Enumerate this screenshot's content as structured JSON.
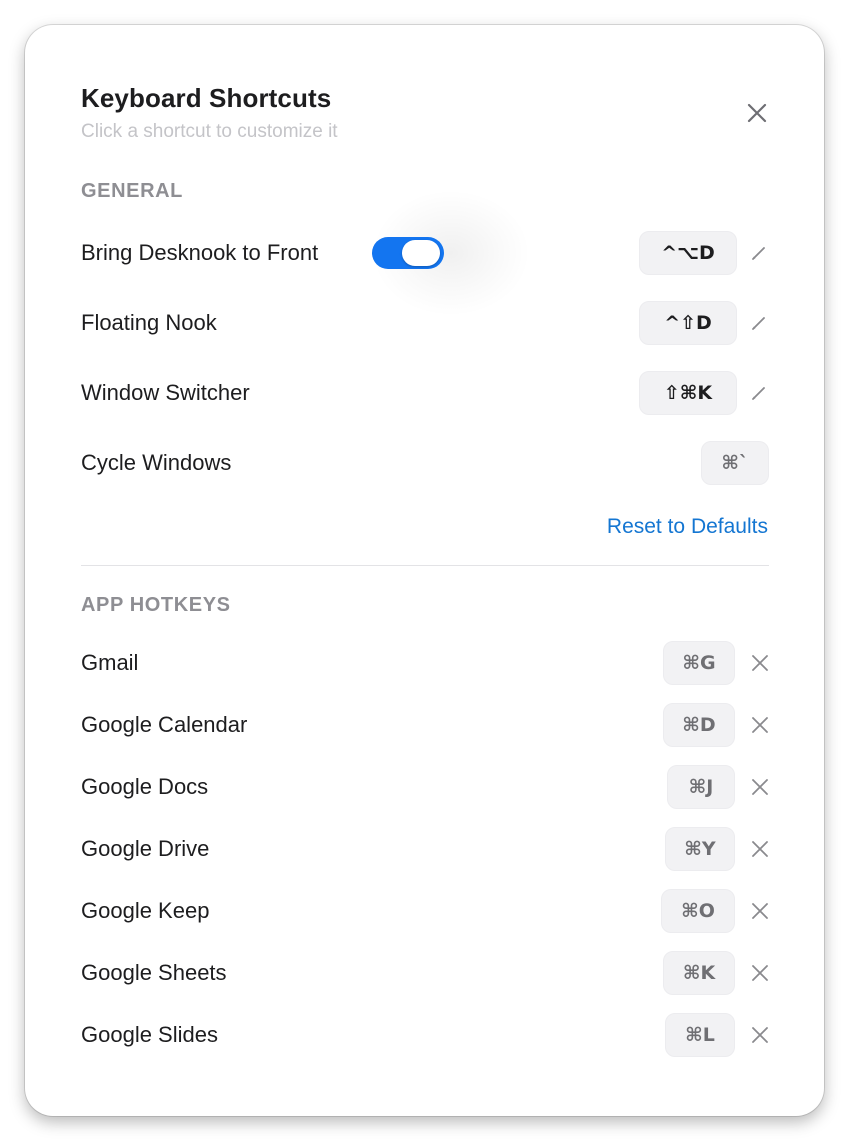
{
  "dialog": {
    "title": "Keyboard Shortcuts",
    "subtitle": "Click a shortcut to customize it",
    "close_icon": "close-icon"
  },
  "general": {
    "section_label": "GENERAL",
    "items": [
      {
        "label": "Bring Desknook to Front",
        "shortcut": "^⌥D",
        "toggle_on": true,
        "editable": true
      },
      {
        "label": "Floating Nook",
        "shortcut": "^⇧D",
        "editable": true
      },
      {
        "label": "Window Switcher",
        "shortcut": "⇧⌘K",
        "editable": true
      },
      {
        "label": "Cycle Windows",
        "shortcut": "⌘`",
        "editable": false
      }
    ],
    "reset_label": "Reset to Defaults"
  },
  "app_hotkeys": {
    "section_label": "APP HOTKEYS",
    "items": [
      {
        "label": "Gmail",
        "shortcut": "⌘G"
      },
      {
        "label": "Google Calendar",
        "shortcut": "⌘D"
      },
      {
        "label": "Google Docs",
        "shortcut": "⌘J"
      },
      {
        "label": "Google Drive",
        "shortcut": "⌘Y"
      },
      {
        "label": "Google Keep",
        "shortcut": "⌘O"
      },
      {
        "label": "Google Sheets",
        "shortcut": "⌘K"
      },
      {
        "label": "Google Slides",
        "shortcut": "⌘L"
      }
    ]
  },
  "colors": {
    "accent": "#1375f0",
    "link": "#1476d2",
    "keycap_bg": "#f2f2f4",
    "section_label": "#8e8e93"
  }
}
